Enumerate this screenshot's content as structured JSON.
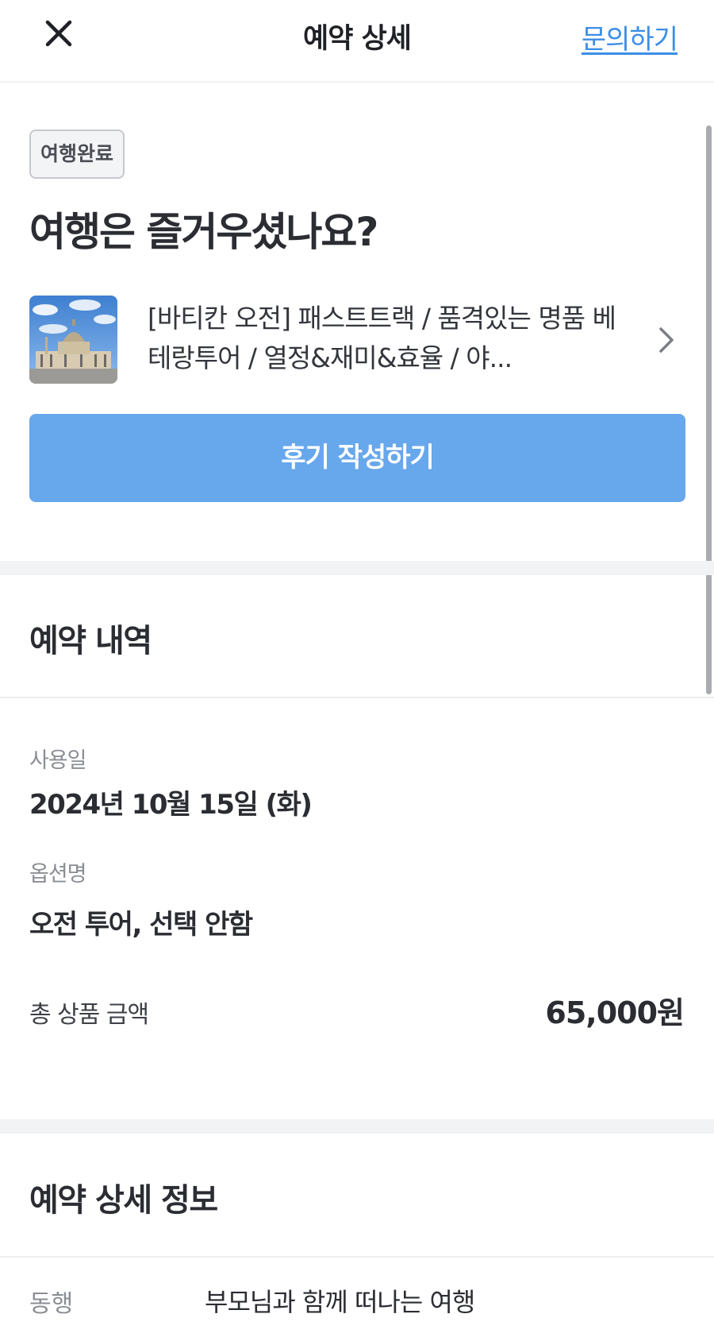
{
  "header": {
    "title": "예약 상세",
    "inquiry_label": "문의하기"
  },
  "status": {
    "badge": "여행완료",
    "headline": "여행은 즐거우셨나요?"
  },
  "product": {
    "title": "[바티칸 오전] 패스트트랙 / 품격있는 명품 베테랑투어 / 열정&재미&효율 / 야...",
    "thumbnail_icon": "basilica-photo"
  },
  "review_button": "후기 작성하기",
  "reservation": {
    "section_title": "예약 내역",
    "usage_date_label": "사용일",
    "usage_date": "2024년 10월 15일 (화)",
    "option_label": "옵션명",
    "option_value": "오전 투어, 선택 안함",
    "total_label": "총 상품 금액",
    "total_value": "65,000원"
  },
  "detail": {
    "section_title": "예약 상세 정보",
    "companion_label": "동행",
    "companion_value": "부모님과 함께 떠나는 여행"
  },
  "colors": {
    "accent": "#67a7ec",
    "link": "#3c8ee6",
    "text": "#2b2d33",
    "muted": "#8a8d93"
  }
}
